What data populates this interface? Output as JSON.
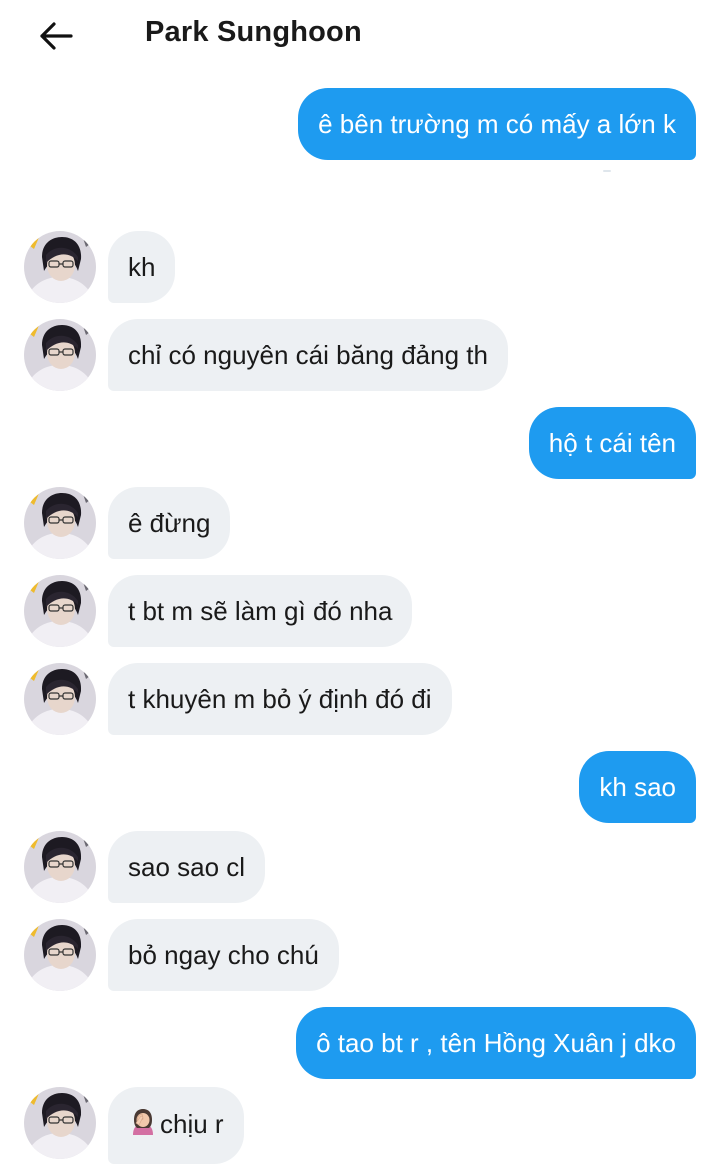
{
  "header": {
    "title": "Park Sunghoon",
    "back_icon": "arrow-left-icon"
  },
  "colors": {
    "outgoing_bubble": "#1e9bf0",
    "incoming_bubble": "#edf0f3"
  },
  "messages": [
    {
      "side": "out",
      "text": "ê bên trường m có mấy a lớn k"
    },
    {
      "side": "in",
      "text": "kh"
    },
    {
      "side": "in",
      "text": "chỉ có nguyên cái băng đảng th"
    },
    {
      "side": "out",
      "text": "hộ t cái tên"
    },
    {
      "side": "in",
      "text": "ê đừng"
    },
    {
      "side": "in",
      "text": "t bt m sẽ làm gì đó nha"
    },
    {
      "side": "in",
      "text": "t khuyên m bỏ ý định đó đi"
    },
    {
      "side": "out",
      "text": "kh sao"
    },
    {
      "side": "in",
      "text": "sao sao cl"
    },
    {
      "side": "in",
      "text": "bỏ ngay cho chú"
    },
    {
      "side": "out",
      "text": "ô tao bt r , tên Hồng Xuân j dko"
    },
    {
      "side": "in",
      "text": "chịu r",
      "emoji": "woman-facepalming-icon"
    }
  ]
}
